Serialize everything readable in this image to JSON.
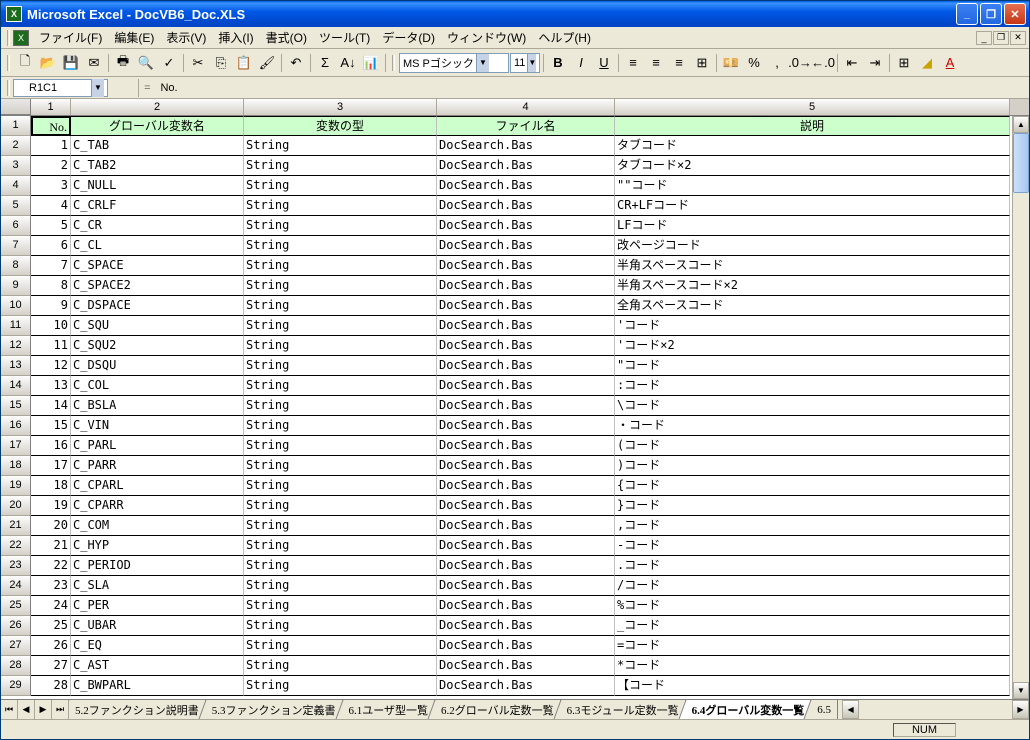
{
  "title": "Microsoft Excel - DocVB6_Doc.XLS",
  "menus": [
    "ファイル(F)",
    "編集(E)",
    "表示(V)",
    "挿入(I)",
    "書式(O)",
    "ツール(T)",
    "データ(D)",
    "ウィンドウ(W)",
    "ヘルプ(H)"
  ],
  "font_name": "MS Pゴシック",
  "font_size": "11",
  "name_box": "R1C1",
  "formula": "No.",
  "col_headers": [
    "1",
    "2",
    "3",
    "4",
    "5"
  ],
  "headers": [
    "No.",
    "グローバル変数名",
    "変数の型",
    "ファイル名",
    "説明"
  ],
  "rows": [
    {
      "n": "1",
      "name": "C_TAB",
      "type": "String",
      "file": "DocSearch.Bas",
      "desc": "タブコード"
    },
    {
      "n": "2",
      "name": "C_TAB2",
      "type": "String",
      "file": "DocSearch.Bas",
      "desc": "タブコード×2"
    },
    {
      "n": "3",
      "name": "C_NULL",
      "type": "String",
      "file": "DocSearch.Bas",
      "desc": "\"\"コード"
    },
    {
      "n": "4",
      "name": "C_CRLF",
      "type": "String",
      "file": "DocSearch.Bas",
      "desc": "CR+LFコード"
    },
    {
      "n": "5",
      "name": "C_CR",
      "type": "String",
      "file": "DocSearch.Bas",
      "desc": "LFコード"
    },
    {
      "n": "6",
      "name": "C_CL",
      "type": "String",
      "file": "DocSearch.Bas",
      "desc": "改ページコード"
    },
    {
      "n": "7",
      "name": "C_SPACE",
      "type": "String",
      "file": "DocSearch.Bas",
      "desc": "半角スペースコード"
    },
    {
      "n": "8",
      "name": "C_SPACE2",
      "type": "String",
      "file": "DocSearch.Bas",
      "desc": "半角スペースコード×2"
    },
    {
      "n": "9",
      "name": "C_DSPACE",
      "type": "String",
      "file": "DocSearch.Bas",
      "desc": "全角スペースコード"
    },
    {
      "n": "10",
      "name": "C_SQU",
      "type": "String",
      "file": "DocSearch.Bas",
      "desc": "'コード"
    },
    {
      "n": "11",
      "name": "C_SQU2",
      "type": "String",
      "file": "DocSearch.Bas",
      "desc": "'コード×2"
    },
    {
      "n": "12",
      "name": "C_DSQU",
      "type": "String",
      "file": "DocSearch.Bas",
      "desc": "\"コード"
    },
    {
      "n": "13",
      "name": "C_COL",
      "type": "String",
      "file": "DocSearch.Bas",
      "desc": ":コード"
    },
    {
      "n": "14",
      "name": "C_BSLA",
      "type": "String",
      "file": "DocSearch.Bas",
      "desc": "\\コード"
    },
    {
      "n": "15",
      "name": "C_VIN",
      "type": "String",
      "file": "DocSearch.Bas",
      "desc": "・コード"
    },
    {
      "n": "16",
      "name": "C_PARL",
      "type": "String",
      "file": "DocSearch.Bas",
      "desc": "(コード"
    },
    {
      "n": "17",
      "name": "C_PARR",
      "type": "String",
      "file": "DocSearch.Bas",
      "desc": ")コード"
    },
    {
      "n": "18",
      "name": "C_CPARL",
      "type": "String",
      "file": "DocSearch.Bas",
      "desc": "{コード"
    },
    {
      "n": "19",
      "name": "C_CPARR",
      "type": "String",
      "file": "DocSearch.Bas",
      "desc": "}コード"
    },
    {
      "n": "20",
      "name": "C_COM",
      "type": "String",
      "file": "DocSearch.Bas",
      "desc": ",コード"
    },
    {
      "n": "21",
      "name": "C_HYP",
      "type": "String",
      "file": "DocSearch.Bas",
      "desc": " -コード"
    },
    {
      "n": "22",
      "name": "C_PERIOD",
      "type": "String",
      "file": "DocSearch.Bas",
      "desc": ".コード"
    },
    {
      "n": "23",
      "name": "C_SLA",
      "type": "String",
      "file": "DocSearch.Bas",
      "desc": "/コード"
    },
    {
      "n": "24",
      "name": "C_PER",
      "type": "String",
      "file": "DocSearch.Bas",
      "desc": "%コード"
    },
    {
      "n": "25",
      "name": "C_UBAR",
      "type": "String",
      "file": "DocSearch.Bas",
      "desc": "_コード"
    },
    {
      "n": "26",
      "name": "C_EQ",
      "type": "String",
      "file": "DocSearch.Bas",
      "desc": " =コード"
    },
    {
      "n": "27",
      "name": "C_AST",
      "type": "String",
      "file": "DocSearch.Bas",
      "desc": "*コード"
    },
    {
      "n": "28",
      "name": "C_BWPARL",
      "type": "String",
      "file": "DocSearch.Bas",
      "desc": "【コード"
    }
  ],
  "tabs": [
    "5.2ファンクション説明書",
    "5.3ファンクション定義書",
    "6.1ユーザ型一覧",
    "6.2グローバル定数一覧",
    "6.3モジュール定数一覧",
    "6.4グローバル変数一覧",
    "6.5"
  ],
  "active_tab": 5,
  "status_num": "NUM"
}
